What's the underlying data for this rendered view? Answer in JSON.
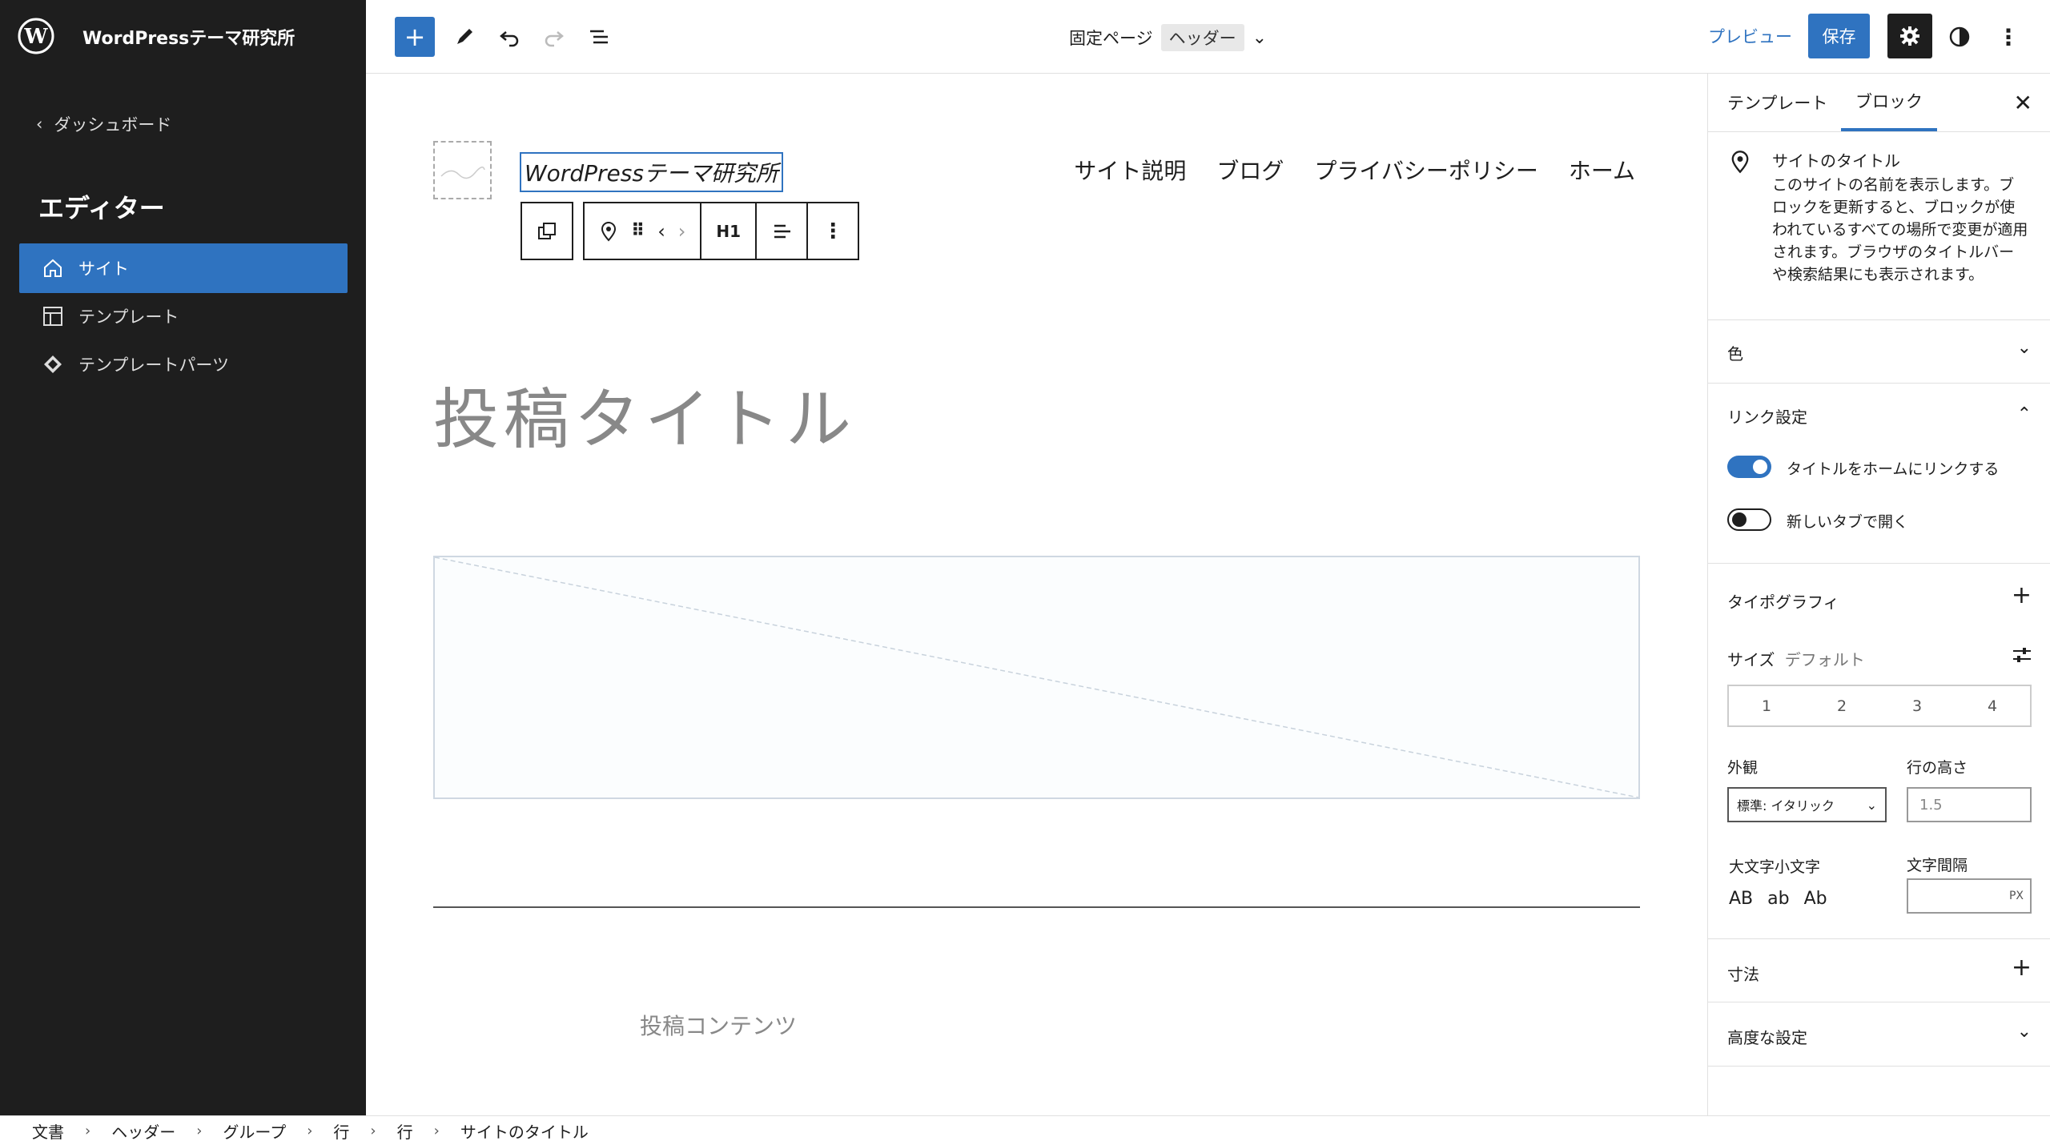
{
  "app": {
    "site_name": "WordPressテーマ研究所",
    "dashboard_link": "ダッシュボード",
    "editor_heading": "エディター"
  },
  "sidebar": {
    "items": [
      {
        "label": "サイト",
        "icon": "home-icon",
        "active": true
      },
      {
        "label": "テンプレート",
        "icon": "layout-icon",
        "active": false
      },
      {
        "label": "テンプレートパーツ",
        "icon": "symbol-icon",
        "active": false
      }
    ]
  },
  "toolbar": {
    "doc_title": "固定ページ",
    "doc_badge": "ヘッダー",
    "preview_label": "プレビュー",
    "save_label": "保存"
  },
  "canvas": {
    "site_title": "WordPressテーマ研究所",
    "nav_items": [
      "サイト説明",
      "ブログ",
      "プライバシーポリシー",
      "ホーム"
    ],
    "block_toolbar_heading_level": "H1",
    "post_title": "投稿タイトル",
    "post_content": "投稿コンテンツ"
  },
  "inspector": {
    "tabs": [
      "テンプレート",
      "ブロック"
    ],
    "active_tab": "ブロック",
    "block_title": "サイトのタイトル",
    "block_description": "このサイトの名前を表示します。ブロックを更新すると、ブロックが使われているすべての場所で変更が適用されます。ブラウザのタイトルバーや検索結果にも表示されます。",
    "panels": {
      "color": "色",
      "link_settings": "リンク設定",
      "link_home_toggle": "タイトルをホームにリンクする",
      "new_tab_toggle": "新しいタブで開く",
      "typography": "タイポグラフィ",
      "size_label": "サイズ",
      "size_value": "デフォルト",
      "size_options": [
        "1",
        "2",
        "3",
        "4"
      ],
      "appearance_label": "外観",
      "appearance_value": "標準: イタリック",
      "line_height_label": "行の高さ",
      "line_height_placeholder": "1.5",
      "letter_case_label": "大文字小文字",
      "letter_case_options": [
        "AB",
        "ab",
        "Ab"
      ],
      "letter_spacing_label": "文字間隔",
      "letter_spacing_unit": "PX",
      "dimensions": "寸法",
      "advanced": "高度な設定"
    },
    "toggles": {
      "link_home": true,
      "new_tab": false
    }
  },
  "breadcrumb": [
    "文書",
    "ヘッダー",
    "グループ",
    "行",
    "行",
    "サイトのタイトル"
  ],
  "colors": {
    "accent": "#2f73c0",
    "sidebar_bg": "#1e1e1e"
  }
}
